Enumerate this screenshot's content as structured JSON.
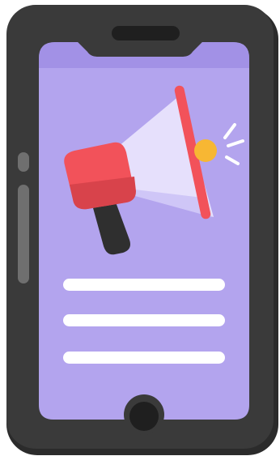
{
  "illustration": {
    "subject": "smartphone-with-megaphone",
    "icons": [
      "phone-icon",
      "megaphone-icon"
    ],
    "colors": {
      "body_dark": "#3a3a3a",
      "body_shadow": "#2b2b2b",
      "side_button": "#6f6f6f",
      "screen": "#b3a4ee",
      "screen_dark": "#9d8ce4",
      "text_line": "#ffffff",
      "megaphone_red": "#f2525a",
      "megaphone_red_dark": "#d8434b",
      "megaphone_cone": "#e6e0fc",
      "megaphone_cone_shadow": "#cfc6f7",
      "megaphone_handle": "#2f2f2f",
      "sound_accent": "#f7b733"
    },
    "text_lines": 3
  }
}
